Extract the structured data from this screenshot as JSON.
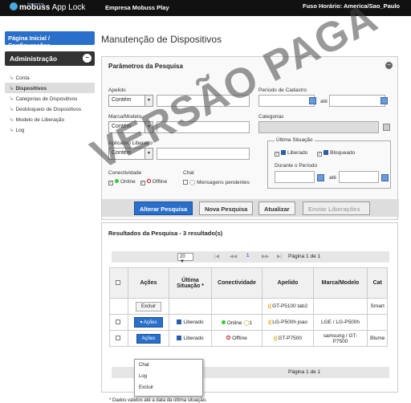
{
  "app": {
    "logo_small": "Powered by",
    "logo_brand": "mobuss",
    "logo_text": "App Lock",
    "company": "Empresa Mobuss Play",
    "timezone": "Fuso Horário: America/Sao_Paulo"
  },
  "sidebar": {
    "home": "Página Inicial / Configurações",
    "section": "Administração",
    "toggle": "−",
    "items": [
      {
        "label": "Conta"
      },
      {
        "label": "Dispositivos"
      },
      {
        "label": "Categorias de Dispositivos"
      },
      {
        "label": "Desbloqueio de Dispositivos"
      },
      {
        "label": "Modelo de Liberação"
      },
      {
        "label": "Log"
      }
    ]
  },
  "page": {
    "title": "Manutenção de Dispositivos"
  },
  "search": {
    "title": "Parâmetros da Pesquisa",
    "collapse": "−",
    "apelido_label": "Apelido",
    "apelido_op": "Contém",
    "marca_label": "Marca/Modelo",
    "marca_op": "Contém",
    "aplicativo_label": "Aplicativo Liberado",
    "aplicativo_op": "Contém",
    "periodo_label": "Período de Cadastro",
    "ate": "até",
    "categorias_label": "Categorias",
    "ultima_legend": "Última Situação",
    "liberado": "Liberado",
    "bloqueado": "Bloqueado",
    "durante_label": "Durante o Período",
    "ate2": "até",
    "conectividade_label": "Conectividade",
    "online": "Online",
    "offline": "Offline",
    "chat_label": "Chat",
    "mensagens": "Mensagens pendentes",
    "check": "✓",
    "arrow": "▼",
    "btn_alterar": "Alterar Pesquisa",
    "btn_nova": "Nova Pesquisa",
    "btn_atualizar": "Atualizar",
    "btn_enviar": "Enviar Liberações"
  },
  "results": {
    "title": "Resultados da Pesquisa - 3 resultado(s)",
    "page_size": "20",
    "page_size_arrow": "▼",
    "page_info": "Página 1 de 1",
    "nav_first": "|◀",
    "nav_prev": "◀◀",
    "nav_page": "1",
    "nav_next": "▶▶",
    "nav_last": "▶|",
    "columns": [
      "Ações",
      "Última Situação *",
      "Conectividade",
      "Apelido",
      "Marca/Modelo",
      "Cat"
    ],
    "rows": [
      {
        "action": "Excluir",
        "situacao": "",
        "conectividade": "",
        "apelido": "GT-P5100 tab2",
        "marca": "",
        "cat": "Smart"
      },
      {
        "action": "Ações",
        "situacao": "Liberado",
        "conectividade": "Online",
        "chat": "1",
        "apelido": "LG-P500h joao",
        "marca": "LGE / LG-P500h",
        "cat": ""
      },
      {
        "action": "Ações",
        "situacao": "Liberado",
        "conectividade": "Offline",
        "apelido": "GT-P7500",
        "marca": "samsung / GT-P7500",
        "cat": "Blume"
      }
    ],
    "dropdown": [
      "Chat",
      "Log",
      "Excluir"
    ],
    "footnote": "* Dados válidos até a data da última situação."
  },
  "watermark": "VERSÃO PAGA"
}
